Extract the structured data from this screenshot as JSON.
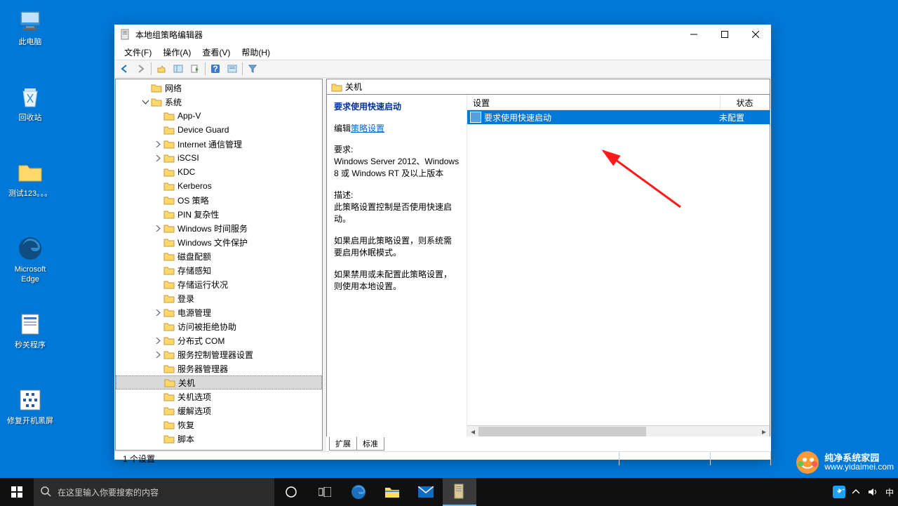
{
  "desktop": {
    "icons": [
      {
        "label": "此电脑",
        "icon": "pc"
      },
      {
        "label": "回收站",
        "icon": "recycle"
      },
      {
        "label": "测试123。。。",
        "icon": "folder"
      },
      {
        "label": "Microsoft Edge",
        "icon": "edge"
      },
      {
        "label": "秒关程序",
        "icon": "app"
      },
      {
        "label": "修复开机黑屏",
        "icon": "fix"
      }
    ]
  },
  "window": {
    "title": "本地组策略编辑器",
    "menu": [
      "文件(F)",
      "操作(A)",
      "查看(V)",
      "帮助(H)"
    ],
    "tree": [
      {
        "indent": 2,
        "exp": "leaf",
        "label": "网络"
      },
      {
        "indent": 2,
        "exp": "open",
        "label": "系统"
      },
      {
        "indent": 3,
        "exp": "leaf",
        "label": "App-V"
      },
      {
        "indent": 3,
        "exp": "leaf",
        "label": "Device Guard"
      },
      {
        "indent": 3,
        "exp": "closed",
        "label": "Internet 通信管理"
      },
      {
        "indent": 3,
        "exp": "closed",
        "label": "iSCSI"
      },
      {
        "indent": 3,
        "exp": "leaf",
        "label": "KDC"
      },
      {
        "indent": 3,
        "exp": "leaf",
        "label": "Kerberos"
      },
      {
        "indent": 3,
        "exp": "leaf",
        "label": "OS 策略"
      },
      {
        "indent": 3,
        "exp": "leaf",
        "label": "PIN 复杂性"
      },
      {
        "indent": 3,
        "exp": "closed",
        "label": "Windows 时间服务"
      },
      {
        "indent": 3,
        "exp": "leaf",
        "label": "Windows 文件保护"
      },
      {
        "indent": 3,
        "exp": "leaf",
        "label": "磁盘配额"
      },
      {
        "indent": 3,
        "exp": "leaf",
        "label": "存储感知"
      },
      {
        "indent": 3,
        "exp": "leaf",
        "label": "存储运行状况"
      },
      {
        "indent": 3,
        "exp": "leaf",
        "label": "登录"
      },
      {
        "indent": 3,
        "exp": "closed",
        "label": "电源管理"
      },
      {
        "indent": 3,
        "exp": "leaf",
        "label": "访问被拒绝协助"
      },
      {
        "indent": 3,
        "exp": "closed",
        "label": "分布式 COM"
      },
      {
        "indent": 3,
        "exp": "closed",
        "label": "服务控制管理器设置"
      },
      {
        "indent": 3,
        "exp": "leaf",
        "label": "服务器管理器"
      },
      {
        "indent": 3,
        "exp": "leaf",
        "label": "关机",
        "selected": true
      },
      {
        "indent": 3,
        "exp": "leaf",
        "label": "关机选项"
      },
      {
        "indent": 3,
        "exp": "leaf",
        "label": "缓解选项"
      },
      {
        "indent": 3,
        "exp": "leaf",
        "label": "恢复"
      },
      {
        "indent": 3,
        "exp": "leaf",
        "label": "脚本"
      }
    ],
    "right": {
      "header": "关机",
      "policy_title": "要求使用快速启动",
      "edit_prefix": "编辑",
      "edit_link": "策略设置",
      "req_label": "要求:",
      "req_text": "Windows Server 2012、Windows 8 或 Windows RT 及以上版本",
      "desc_label": "描述:",
      "desc_text": "此策略设置控制是否使用快速启动。",
      "desc_p2": "如果启用此策略设置，则系统需要启用休眠模式。",
      "desc_p3": "如果禁用或未配置此策略设置，则使用本地设置。",
      "columns": {
        "name": "设置",
        "status": "状态"
      },
      "row": {
        "name": "要求使用快速启动",
        "status": "未配置"
      },
      "tabs": [
        "扩展",
        "标准"
      ]
    },
    "statusbar": "1 个设置"
  },
  "taskbar": {
    "search_placeholder": "在这里输入你要搜索的内容",
    "tray_lang": "中"
  },
  "watermark": {
    "line1": "纯净系统家园",
    "line2": "www.yidaimei.com"
  }
}
